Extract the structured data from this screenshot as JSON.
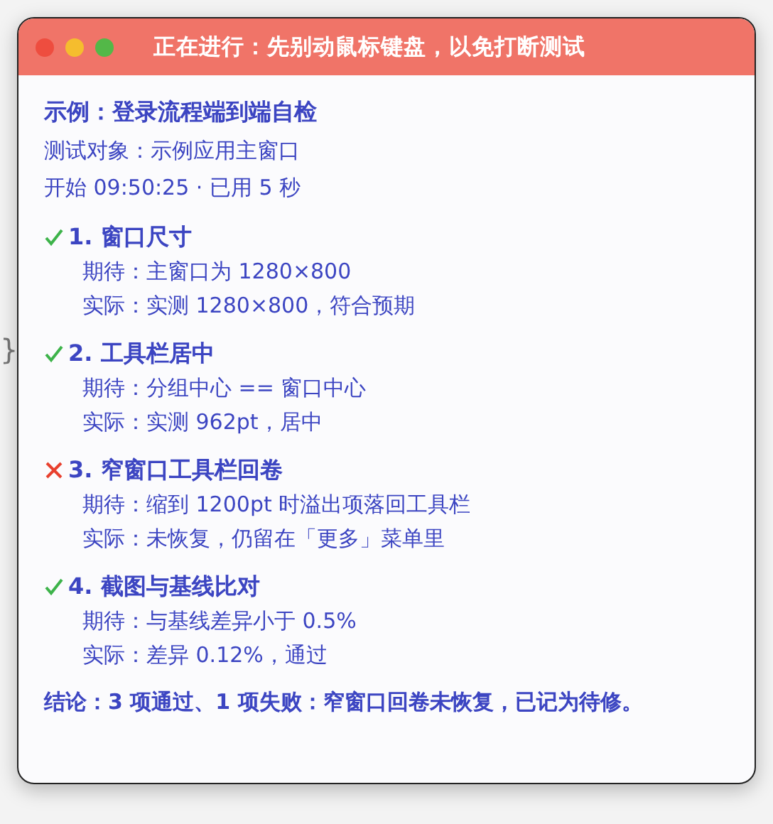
{
  "background": {
    "lines": [
      {
        "text": "}",
        "kind": "brace"
      }
    ]
  },
  "window": {
    "title": "正在进行：先别动鼠标键盘，以免打断测试",
    "heading": "示例：登录流程端到端自检",
    "target": "测试对象：示例应用主窗口",
    "timing": "开始 09:50:25 · 已用 5 秒",
    "checks": [
      {
        "title": "1. 窗口尺寸",
        "passed": true,
        "expected": "期待：主窗口为 1280×800",
        "actual": "实际：实测 1280×800，符合预期"
      },
      {
        "title": "2. 工具栏居中",
        "passed": true,
        "expected": "期待：分组中心 == 窗口中心",
        "actual": "实际：实测 962pt，居中"
      },
      {
        "title": "3. 窄窗口工具栏回卷",
        "passed": false,
        "expected": "期待：缩到 1200pt 时溢出项落回工具栏",
        "actual": "实际：未恢复，仍留在「更多」菜单里"
      },
      {
        "title": "4. 截图与基线比对",
        "passed": true,
        "expected": "期待：与基线差异小于 0.5%",
        "actual": "实际：差异 0.12%，通过"
      }
    ],
    "conclusion": "结论：3 项通过、1 项失败：窄窗口回卷未恢复，已记为待修。"
  }
}
